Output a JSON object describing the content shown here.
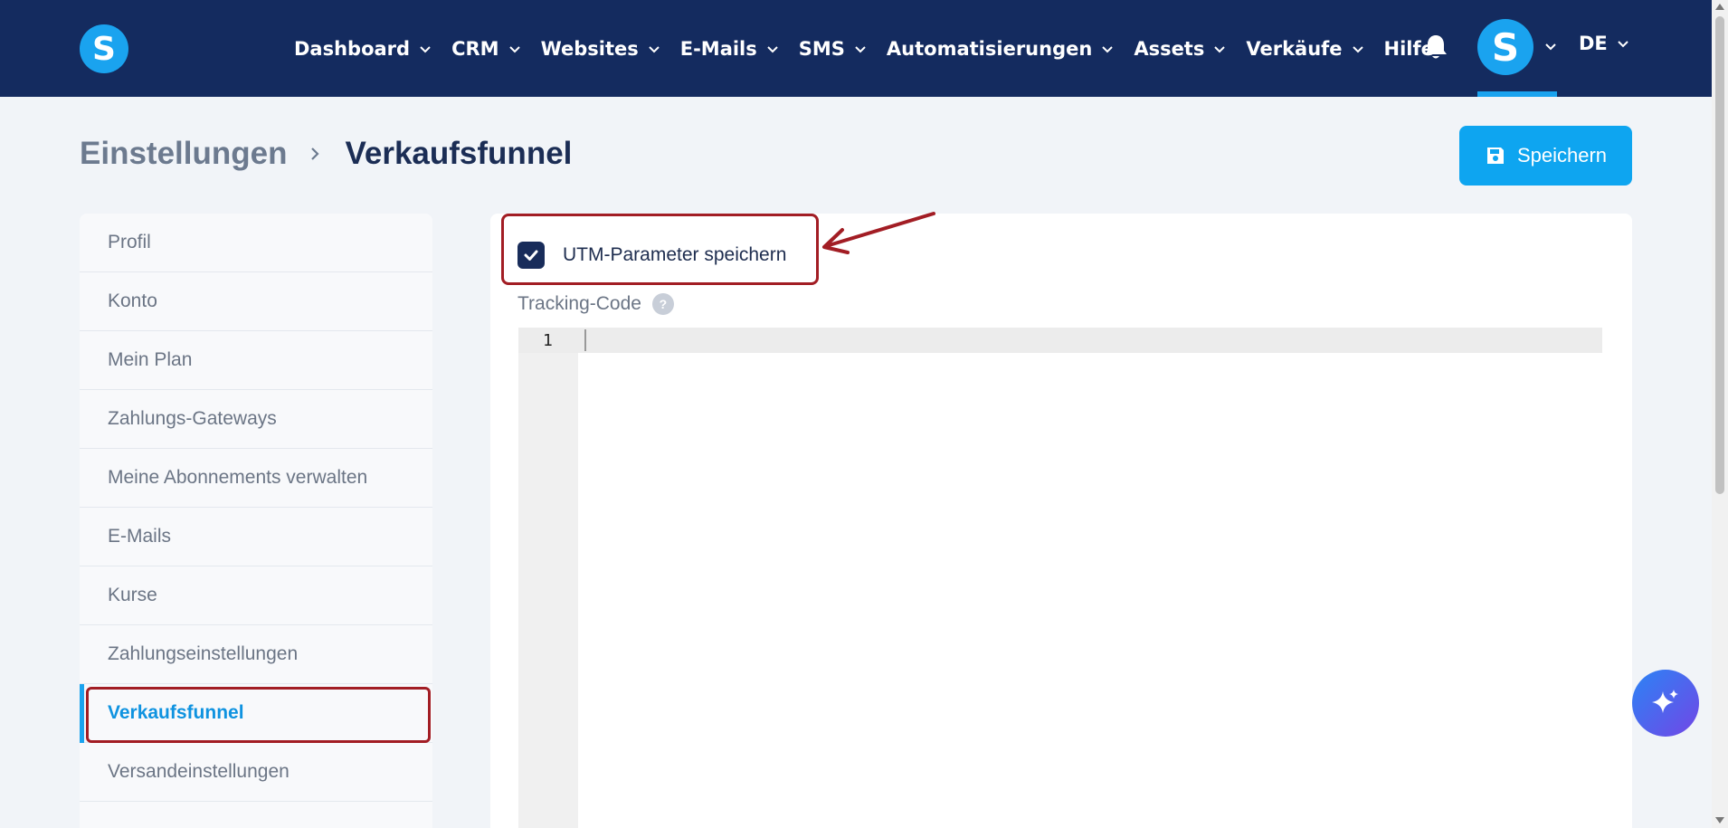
{
  "brand": {
    "logo_letter": "S"
  },
  "nav": {
    "items": [
      {
        "label": "Dashboard",
        "dropdown": true
      },
      {
        "label": "CRM",
        "dropdown": true
      },
      {
        "label": "Websites",
        "dropdown": true
      },
      {
        "label": "E-Mails",
        "dropdown": true
      },
      {
        "label": "SMS",
        "dropdown": true
      },
      {
        "label": "Automatisierungen",
        "dropdown": true
      },
      {
        "label": "Assets",
        "dropdown": true
      },
      {
        "label": "Verkäufe",
        "dropdown": true
      },
      {
        "label": "Hilfe",
        "dropdown": false
      }
    ],
    "avatar_letter": "S",
    "language": "DE"
  },
  "breadcrumb": {
    "root": "Einstellungen",
    "current": "Verkaufsfunnel"
  },
  "toolbar": {
    "save_label": "Speichern"
  },
  "sidebar": {
    "items": [
      {
        "label": "Profil"
      },
      {
        "label": "Konto"
      },
      {
        "label": "Mein Plan"
      },
      {
        "label": "Zahlungs-Gateways"
      },
      {
        "label": "Meine Abonnements verwalten"
      },
      {
        "label": "E-Mails"
      },
      {
        "label": "Kurse"
      },
      {
        "label": "Zahlungseinstellungen"
      },
      {
        "label": "Verkaufsfunnel",
        "active": true
      },
      {
        "label": "Versandeinstellungen"
      }
    ]
  },
  "settings": {
    "utm_label": "UTM-Parameter speichern",
    "utm_checked": true,
    "tracking_label": "Tracking-Code",
    "help_symbol": "?",
    "editor_line_number": "1"
  },
  "colors": {
    "nav_bg": "#142b5f",
    "accent": "#1aa3ef",
    "annotation": "#a21d24"
  }
}
